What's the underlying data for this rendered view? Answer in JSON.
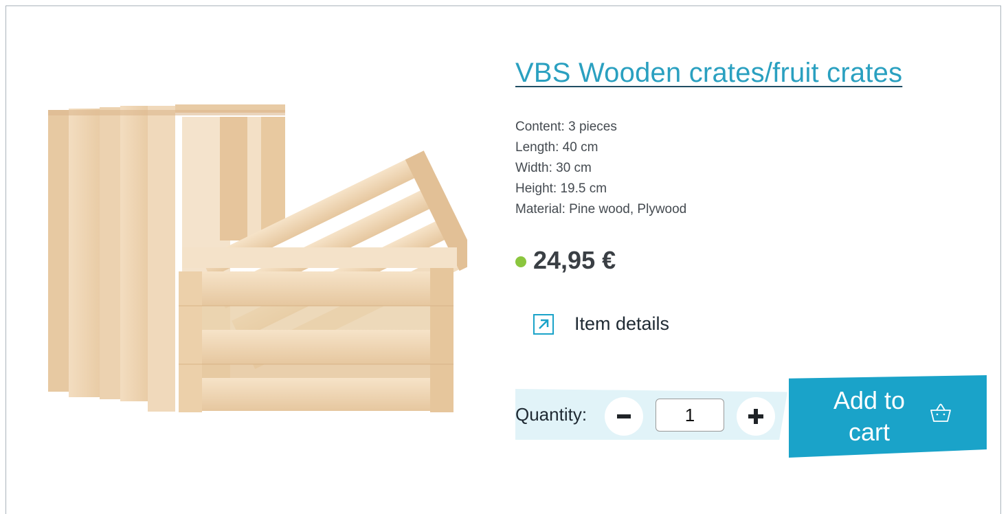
{
  "product": {
    "title": "VBS Wooden crates/fruit crates",
    "specs": [
      "Content: 3 pieces",
      "Length: 40 cm",
      "Width: 30 cm",
      "Height: 19.5 cm",
      "Material: Pine wood, Plywood"
    ],
    "price": "24,95 €",
    "availability_color": "#8bc63e"
  },
  "details_link": {
    "label": "Item details",
    "icon": "arrow-up-right-icon"
  },
  "quantity": {
    "label": "Quantity:",
    "value": "1",
    "minus_icon": "minus-icon",
    "plus_icon": "plus-icon"
  },
  "cart": {
    "label_line1": "Add to",
    "label_line2": "cart",
    "icon": "basket-icon"
  },
  "colors": {
    "accent": "#1aa3c9",
    "title": "#2aa0c0",
    "quantity_band": "#e1f3f8"
  }
}
